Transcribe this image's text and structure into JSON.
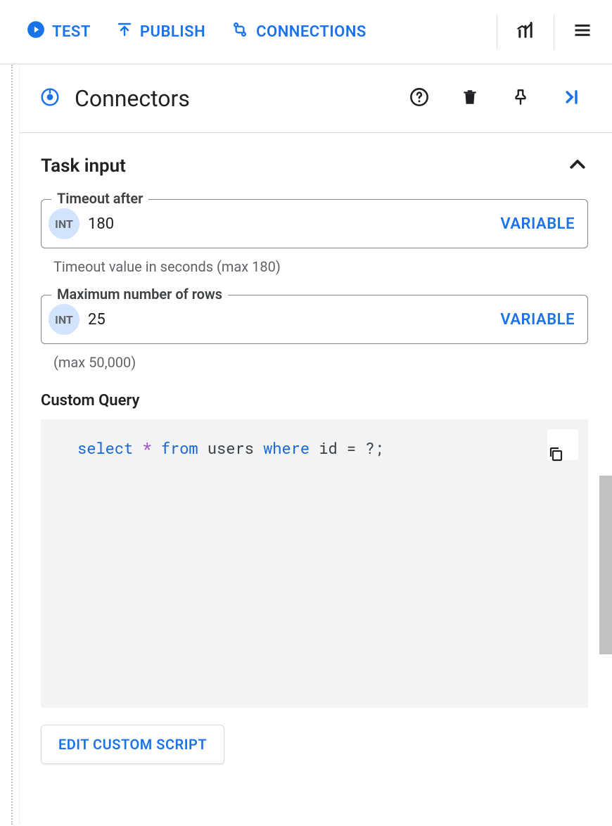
{
  "toolbar": {
    "test": "TEST",
    "publish": "PUBLISH",
    "connections": "CONNECTIONS"
  },
  "header": {
    "title": "Connectors"
  },
  "section": {
    "title": "Task input"
  },
  "fields": {
    "timeout": {
      "label": "Timeout after",
      "chip": "INT",
      "value": "180",
      "variable_btn": "VARIABLE",
      "helper": "Timeout value in seconds (max 180)"
    },
    "maxrows": {
      "label": "Maximum number of rows",
      "chip": "INT",
      "value": "25",
      "variable_btn": "VARIABLE",
      "helper": "(max 50,000)"
    }
  },
  "custom_query": {
    "label": "Custom Query",
    "tokens": {
      "select": "select",
      "star": "*",
      "from": "from",
      "users": "users",
      "where": "where",
      "id": "id",
      "eq": "=",
      "q": "?",
      "semi": ";"
    }
  },
  "buttons": {
    "edit_script": "EDIT CUSTOM SCRIPT"
  }
}
